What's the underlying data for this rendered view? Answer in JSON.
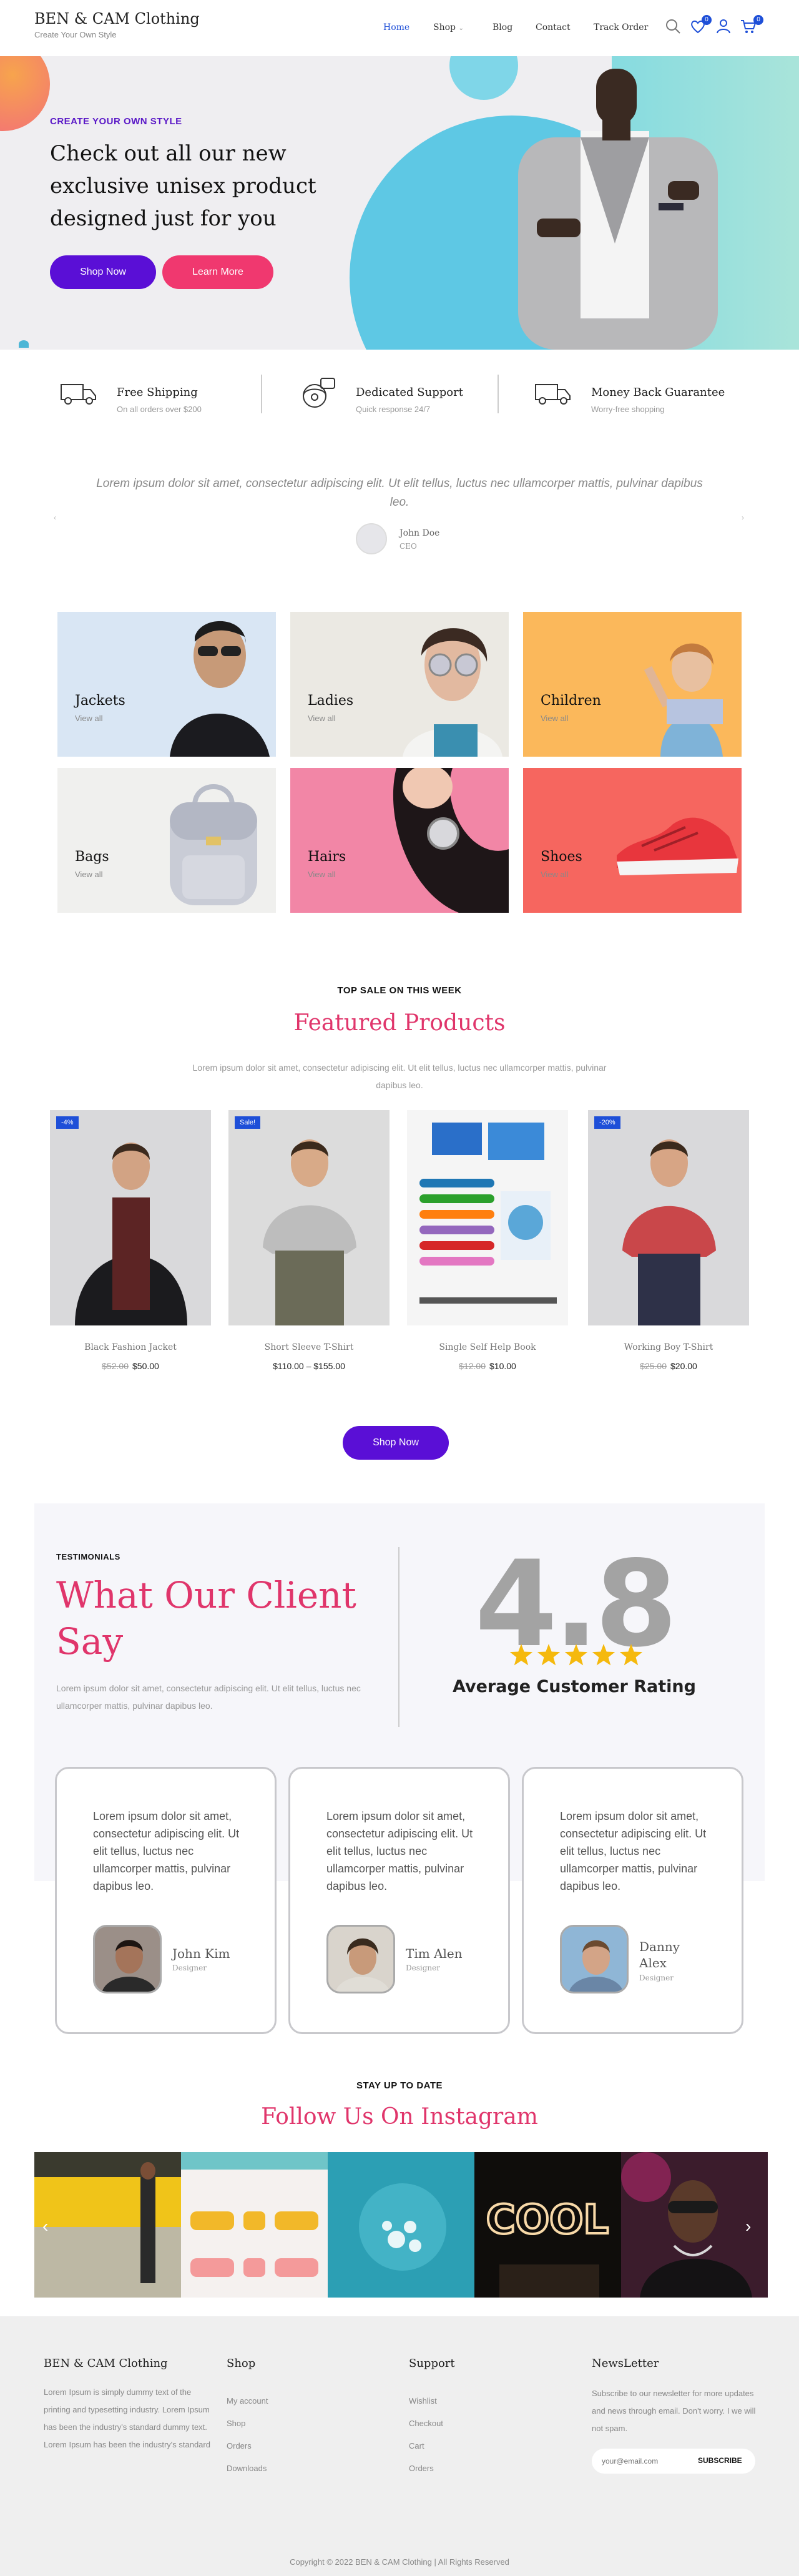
{
  "header": {
    "brand": "BEN & CAM Clothing",
    "tagline": "Create Your Own Style",
    "nav": [
      "Home",
      "Shop",
      "Blog",
      "Contact",
      "Track Order"
    ],
    "wishlist_count": "0",
    "cart_count": "0"
  },
  "hero": {
    "kicker": "CREATE YOUR OWN STYLE",
    "title": "Check out all our new exclusive unisex product designed just for you",
    "shop_now": "Shop Now",
    "learn_more": "Learn More"
  },
  "features": [
    {
      "title": "Free Shipping",
      "subtitle": "On all orders over $200",
      "icon": "truck-icon"
    },
    {
      "title": "Dedicated Support",
      "subtitle": "Quick response 24/7",
      "icon": "support-icon"
    },
    {
      "title": "Money Back Guarantee",
      "subtitle": "Worry-free shopping",
      "icon": "truck-return-icon"
    }
  ],
  "quote": {
    "text": "Lorem ipsum dolor sit amet, consectetur adipiscing elit. Ut elit tellus, luctus nec ullamcorper mattis, pulvinar dapibus leo.",
    "author": "John Doe",
    "role": "CEO"
  },
  "categories": [
    {
      "title": "Jackets",
      "link": "View all",
      "bg": "#d9e6f4"
    },
    {
      "title": "Ladies",
      "link": "View all",
      "bg": "#ebe9e3"
    },
    {
      "title": "Children",
      "link": "View all",
      "bg": "#fbb85b"
    },
    {
      "title": "Bags",
      "link": "View all",
      "bg": "#f0f0ee"
    },
    {
      "title": "Hairs",
      "link": "View all",
      "bg": "#f286a6"
    },
    {
      "title": "Shoes",
      "link": "View all",
      "bg": "#f6665f"
    }
  ],
  "featured": {
    "kicker": "TOP SALE ON THIS WEEK",
    "title": "Featured Products",
    "description": "Lorem ipsum dolor sit amet, consectetur adipiscing elit. Ut elit tellus, luctus nec ullamcorper mattis, pulvinar dapibus leo.",
    "button": "Shop Now",
    "products": [
      {
        "name": "Black Fashion Jacket",
        "badge": "-4%",
        "old_price": "$52.00",
        "price": "$50.00"
      },
      {
        "name": "Short Sleeve T-Shirt",
        "badge": "Sale!",
        "old_price": "",
        "price": "$110.00 – $155.00"
      },
      {
        "name": "Single Self Help Book",
        "badge": "",
        "old_price": "$12.00",
        "price": "$10.00"
      },
      {
        "name": "Working Boy T-Shirt",
        "badge": "-20%",
        "old_price": "$25.00",
        "price": "$20.00"
      }
    ]
  },
  "testimonials": {
    "kicker": "TESTIMONIALS",
    "title": "What Our Client Say",
    "description": "Lorem ipsum dolor sit amet, consectetur adipiscing elit. Ut elit tellus, luctus nec ullamcorper mattis, pulvinar dapibus leo.",
    "rating": "4.8",
    "rating_label": "Average Customer Rating",
    "stars": 5,
    "cards": [
      {
        "text": "Lorem ipsum dolor sit amet, consectetur adipiscing elit. Ut elit tellus, luctus nec ullamcorper mattis, pulvinar dapibus leo.",
        "name": "John Kim",
        "role": "Designer"
      },
      {
        "text": "Lorem ipsum dolor sit amet, consectetur adipiscing elit. Ut elit tellus, luctus nec ullamcorper mattis, pulvinar dapibus leo.",
        "name": "Tim Alen",
        "role": "Designer"
      },
      {
        "text": "Lorem ipsum dolor sit amet, consectetur adipiscing elit. Ut elit tellus, luctus nec ullamcorper mattis, pulvinar dapibus leo.",
        "name": "Danny Alex",
        "role": "Designer"
      }
    ]
  },
  "instagram": {
    "kicker": "STAY UP TO DATE",
    "title": "Follow Us On Instagram"
  },
  "footer": {
    "brand": "BEN & CAM Clothing",
    "about": "Lorem Ipsum is simply dummy text of the printing and typesetting industry. Lorem Ipsum has been the industry's standard dummy text. Lorem Ipsum has been the industry's standard",
    "shop_title": "Shop",
    "shop_links": [
      "My account",
      "Shop",
      "Orders",
      "Downloads"
    ],
    "support_title": "Support",
    "support_links": [
      "Wishlist",
      "Checkout",
      "Cart",
      "Orders"
    ],
    "newsletter_title": "NewsLetter",
    "newsletter_text": "Subscribe to our newsletter for more updates and news through email. Don't worry. I we will not spam.",
    "email_placeholder": "your@email.com",
    "subscribe": "SUBSCRIBE",
    "copyright": "Copyright © 2022 BEN & CAM Clothing | All Rights Reserved"
  },
  "colors": {
    "accent": "#5a0fd6",
    "pink": "#f0386f",
    "blue": "#1e4fd8",
    "star": "#f5b90d"
  }
}
